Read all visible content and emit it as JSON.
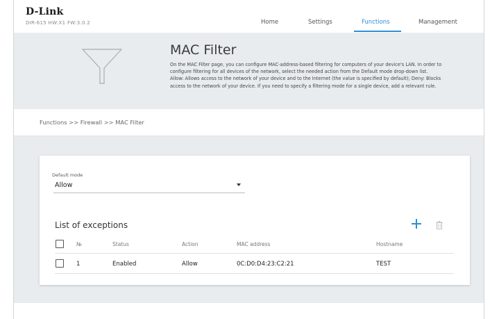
{
  "header": {
    "brand": "D-Link",
    "device_info": "DIR-615 HW:X1 FW:3.0.2",
    "nav": [
      {
        "label": "Home"
      },
      {
        "label": "Settings"
      },
      {
        "label": "Functions"
      },
      {
        "label": "Management"
      }
    ],
    "active_tab": "Functions",
    "accent_color": "#2f8fd5"
  },
  "banner": {
    "icon": "funnel-icon",
    "title": "MAC Filter",
    "description": "On the MAC Filter page, you can configure MAC-address-based filtering for computers of your device's LAN. In order to configure filtering for all devices of the network, select the needed action from the Default mode drop-down list. Allow: Allows access to the network of your device and to the Internet (the value is specified by default); Deny: Blocks access to the network of your device. If you need to specify a filtering mode for a single device, add a relevant rule."
  },
  "breadcrumb": "Functions >> Firewall >> MAC Filter",
  "default_mode": {
    "label": "Default mode",
    "value": "Allow"
  },
  "exceptions": {
    "title": "List of exceptions",
    "columns": {
      "number": "№",
      "status": "Status",
      "action": "Action",
      "mac": "MAC address",
      "hostname": "Hostname"
    },
    "rows": [
      {
        "number": "1",
        "status": "Enabled",
        "action": "Allow",
        "mac": "0C:D0:D4:23:C2:21",
        "hostname": "TEST"
      }
    ]
  }
}
